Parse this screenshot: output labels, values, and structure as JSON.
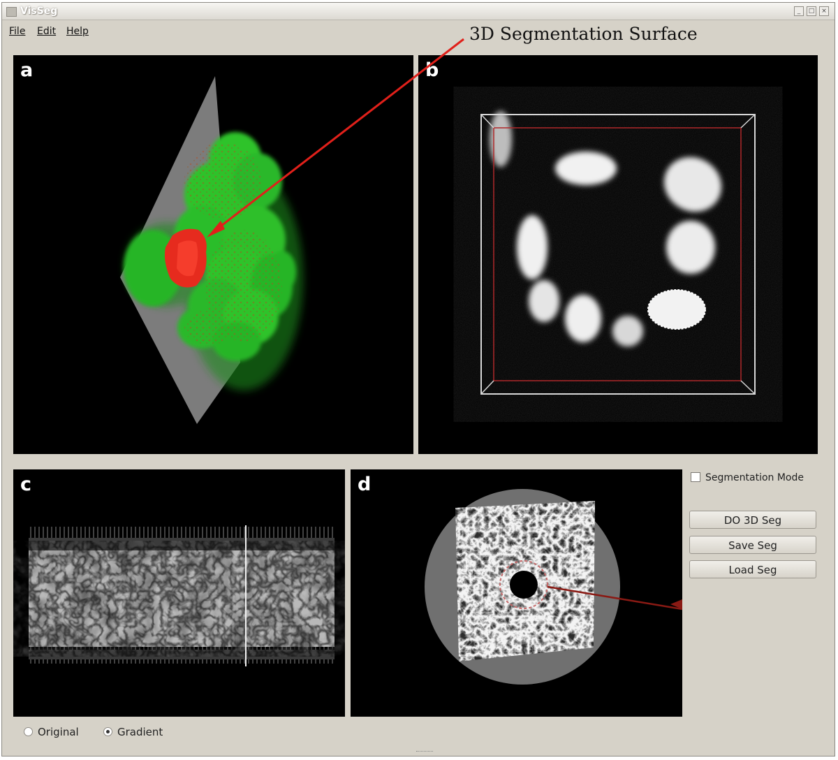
{
  "window": {
    "title": "VisSeg"
  },
  "menu": {
    "items": [
      "File",
      "Edit",
      "Help"
    ]
  },
  "annotation": {
    "label": "3D Segmentation Surface"
  },
  "panels": [
    {
      "id": "a",
      "label": "a"
    },
    {
      "id": "b",
      "label": "b"
    },
    {
      "id": "c",
      "label": "c"
    },
    {
      "id": "d",
      "label": "d"
    }
  ],
  "controls": {
    "segmentation_mode_label": "Segmentation Mode",
    "segmentation_mode_checked": false,
    "buttons": [
      "DO 3D Seg",
      "Save Seg",
      "Load Seg"
    ]
  },
  "view_mode": {
    "options": [
      "Original",
      "Gradient"
    ],
    "selected": "Gradient"
  },
  "colors": {
    "window_bg": "#d6d2c8",
    "segmentation_red": "#e62b1e",
    "cells_green": "#2fc32b",
    "arrow_red": "#e0201a"
  }
}
